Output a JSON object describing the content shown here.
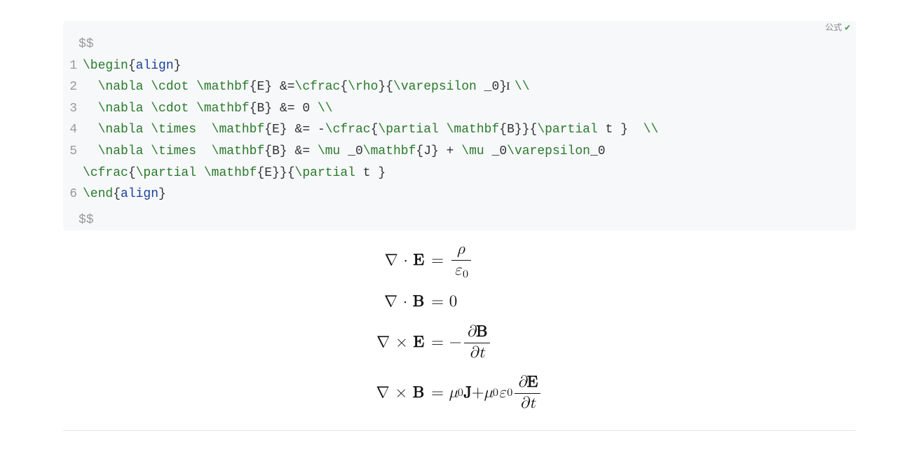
{
  "badge": {
    "label": "公式",
    "check": "✔"
  },
  "delimiter_open": "$$",
  "delimiter_close": "$$",
  "code": {
    "lines": [
      {
        "n": "1",
        "tokens": [
          {
            "cls": "tok-cmd",
            "t": "\\begin"
          },
          {
            "cls": "tok-brace",
            "t": "{"
          },
          {
            "cls": "tok-env",
            "t": "align"
          },
          {
            "cls": "tok-brace",
            "t": "}"
          }
        ]
      },
      {
        "n": "2",
        "indent": "  ",
        "tokens": [
          {
            "cls": "tok-cmd",
            "t": "\\nabla"
          },
          {
            "cls": "",
            "t": " "
          },
          {
            "cls": "tok-cmd",
            "t": "\\cdot"
          },
          {
            "cls": "",
            "t": " "
          },
          {
            "cls": "tok-cmd",
            "t": "\\mathbf"
          },
          {
            "cls": "tok-brace",
            "t": "{"
          },
          {
            "cls": "tok-arg",
            "t": "E"
          },
          {
            "cls": "tok-brace",
            "t": "}"
          },
          {
            "cls": "",
            "t": " "
          },
          {
            "cls": "tok-op",
            "t": "&="
          },
          {
            "cls": "tok-cmd",
            "t": "\\cfrac"
          },
          {
            "cls": "tok-brace",
            "t": "{"
          },
          {
            "cls": "tok-cmd",
            "t": "\\rho"
          },
          {
            "cls": "tok-brace",
            "t": "}"
          },
          {
            "cls": "tok-brace",
            "t": "{"
          },
          {
            "cls": "tok-cmd",
            "t": "\\varepsilon"
          },
          {
            "cls": "",
            "t": " "
          },
          {
            "cls": "tok-op",
            "t": "_"
          },
          {
            "cls": "tok-arg",
            "t": "0"
          },
          {
            "cls": "tok-brace",
            "t": "}"
          },
          {
            "caret": true
          },
          {
            "cls": "",
            "t": " "
          },
          {
            "cls": "tok-cmd",
            "t": "\\\\"
          }
        ]
      },
      {
        "n": "3",
        "indent": "  ",
        "tokens": [
          {
            "cls": "tok-cmd",
            "t": "\\nabla"
          },
          {
            "cls": "",
            "t": " "
          },
          {
            "cls": "tok-cmd",
            "t": "\\cdot"
          },
          {
            "cls": "",
            "t": " "
          },
          {
            "cls": "tok-cmd",
            "t": "\\mathbf"
          },
          {
            "cls": "tok-brace",
            "t": "{"
          },
          {
            "cls": "tok-arg",
            "t": "B"
          },
          {
            "cls": "tok-brace",
            "t": "}"
          },
          {
            "cls": "",
            "t": " "
          },
          {
            "cls": "tok-op",
            "t": "&="
          },
          {
            "cls": "",
            "t": " "
          },
          {
            "cls": "tok-arg",
            "t": "0"
          },
          {
            "cls": "",
            "t": " "
          },
          {
            "cls": "tok-cmd",
            "t": "\\\\"
          }
        ]
      },
      {
        "n": "4",
        "indent": "  ",
        "tokens": [
          {
            "cls": "tok-cmd",
            "t": "\\nabla"
          },
          {
            "cls": "",
            "t": " "
          },
          {
            "cls": "tok-cmd",
            "t": "\\times"
          },
          {
            "cls": "",
            "t": "  "
          },
          {
            "cls": "tok-cmd",
            "t": "\\mathbf"
          },
          {
            "cls": "tok-brace",
            "t": "{"
          },
          {
            "cls": "tok-arg",
            "t": "E"
          },
          {
            "cls": "tok-brace",
            "t": "}"
          },
          {
            "cls": "",
            "t": " "
          },
          {
            "cls": "tok-op",
            "t": "&="
          },
          {
            "cls": "",
            "t": " "
          },
          {
            "cls": "tok-op",
            "t": "-"
          },
          {
            "cls": "tok-cmd",
            "t": "\\cfrac"
          },
          {
            "cls": "tok-brace",
            "t": "{"
          },
          {
            "cls": "tok-cmd",
            "t": "\\partial"
          },
          {
            "cls": "",
            "t": " "
          },
          {
            "cls": "tok-cmd",
            "t": "\\mathbf"
          },
          {
            "cls": "tok-brace",
            "t": "{"
          },
          {
            "cls": "tok-arg",
            "t": "B"
          },
          {
            "cls": "tok-brace",
            "t": "}"
          },
          {
            "cls": "tok-brace",
            "t": "}"
          },
          {
            "cls": "tok-brace",
            "t": "{"
          },
          {
            "cls": "tok-cmd",
            "t": "\\partial"
          },
          {
            "cls": "",
            "t": " "
          },
          {
            "cls": "tok-arg",
            "t": "t"
          },
          {
            "cls": "",
            "t": " "
          },
          {
            "cls": "tok-brace",
            "t": "}"
          },
          {
            "cls": "",
            "t": "  "
          },
          {
            "cls": "tok-cmd",
            "t": "\\\\"
          }
        ]
      },
      {
        "n": "5",
        "indent": "  ",
        "tokens": [
          {
            "cls": "tok-cmd",
            "t": "\\nabla"
          },
          {
            "cls": "",
            "t": " "
          },
          {
            "cls": "tok-cmd",
            "t": "\\times"
          },
          {
            "cls": "",
            "t": "  "
          },
          {
            "cls": "tok-cmd",
            "t": "\\mathbf"
          },
          {
            "cls": "tok-brace",
            "t": "{"
          },
          {
            "cls": "tok-arg",
            "t": "B"
          },
          {
            "cls": "tok-brace",
            "t": "}"
          },
          {
            "cls": "",
            "t": " "
          },
          {
            "cls": "tok-op",
            "t": "&="
          },
          {
            "cls": "",
            "t": " "
          },
          {
            "cls": "tok-cmd",
            "t": "\\mu"
          },
          {
            "cls": "",
            "t": " "
          },
          {
            "cls": "tok-op",
            "t": "_"
          },
          {
            "cls": "tok-arg",
            "t": "0"
          },
          {
            "cls": "tok-cmd",
            "t": "\\mathbf"
          },
          {
            "cls": "tok-brace",
            "t": "{"
          },
          {
            "cls": "tok-arg",
            "t": "J"
          },
          {
            "cls": "tok-brace",
            "t": "}"
          },
          {
            "cls": "",
            "t": " "
          },
          {
            "cls": "tok-op",
            "t": "+"
          },
          {
            "cls": "",
            "t": " "
          },
          {
            "cls": "tok-cmd",
            "t": "\\mu"
          },
          {
            "cls": "",
            "t": " "
          },
          {
            "cls": "tok-op",
            "t": "_"
          },
          {
            "cls": "tok-arg",
            "t": "0"
          },
          {
            "cls": "tok-cmd",
            "t": "\\varepsilon"
          },
          {
            "cls": "tok-op",
            "t": "_"
          },
          {
            "cls": "tok-arg",
            "t": "0"
          }
        ],
        "wrap_tokens": [
          {
            "cls": "tok-cmd",
            "t": "\\cfrac"
          },
          {
            "cls": "tok-brace",
            "t": "{"
          },
          {
            "cls": "tok-cmd",
            "t": "\\partial"
          },
          {
            "cls": "",
            "t": " "
          },
          {
            "cls": "tok-cmd",
            "t": "\\mathbf"
          },
          {
            "cls": "tok-brace",
            "t": "{"
          },
          {
            "cls": "tok-arg",
            "t": "E"
          },
          {
            "cls": "tok-brace",
            "t": "}"
          },
          {
            "cls": "tok-brace",
            "t": "}"
          },
          {
            "cls": "tok-brace",
            "t": "{"
          },
          {
            "cls": "tok-cmd",
            "t": "\\partial"
          },
          {
            "cls": "",
            "t": " "
          },
          {
            "cls": "tok-arg",
            "t": "t"
          },
          {
            "cls": "",
            "t": " "
          },
          {
            "cls": "tok-brace",
            "t": "}"
          }
        ]
      },
      {
        "n": "6",
        "tokens": [
          {
            "cls": "tok-cmd",
            "t": "\\end"
          },
          {
            "cls": "tok-brace",
            "t": "{"
          },
          {
            "cls": "tok-env",
            "t": "align"
          },
          {
            "cls": "tok-brace",
            "t": "}"
          }
        ]
      }
    ]
  },
  "rendered": {
    "rows": [
      {
        "lhs_html": "∇ · <span class='mb'>E</span>",
        "rhs_html": "=&nbsp;<span class='frac'><span class='num it'>ρ</span><span class='bar'></span><span class='den'><span class='it'>ε</span><span class='sub'>0</span></span></span>"
      },
      {
        "lhs_html": "∇ · <span class='mb'>B</span>",
        "rhs_html": "=&nbsp;0"
      },
      {
        "lhs_html": "∇ × <span class='mb'>E</span>",
        "rhs_html": "=&nbsp;−<span class='frac'><span class='num'><span class='it'>∂</span><span class='mb'>B</span></span><span class='bar'></span><span class='den'><span class='it'>∂t</span></span></span>"
      },
      {
        "lhs_html": "∇ × <span class='mb'>B</span>",
        "rhs_html": "=&nbsp;<span class='it'>μ</span><span class='sub'>0</span><span class='mb'>J</span> + <span class='it'>μ</span><span class='sub'>0</span><span class='it'>ε</span><span class='sub'>0</span><span class='frac'><span class='num'><span class='it'>∂</span><span class='mb'>E</span></span><span class='bar'></span><span class='den'><span class='it'>∂t</span></span></span>"
      }
    ]
  }
}
